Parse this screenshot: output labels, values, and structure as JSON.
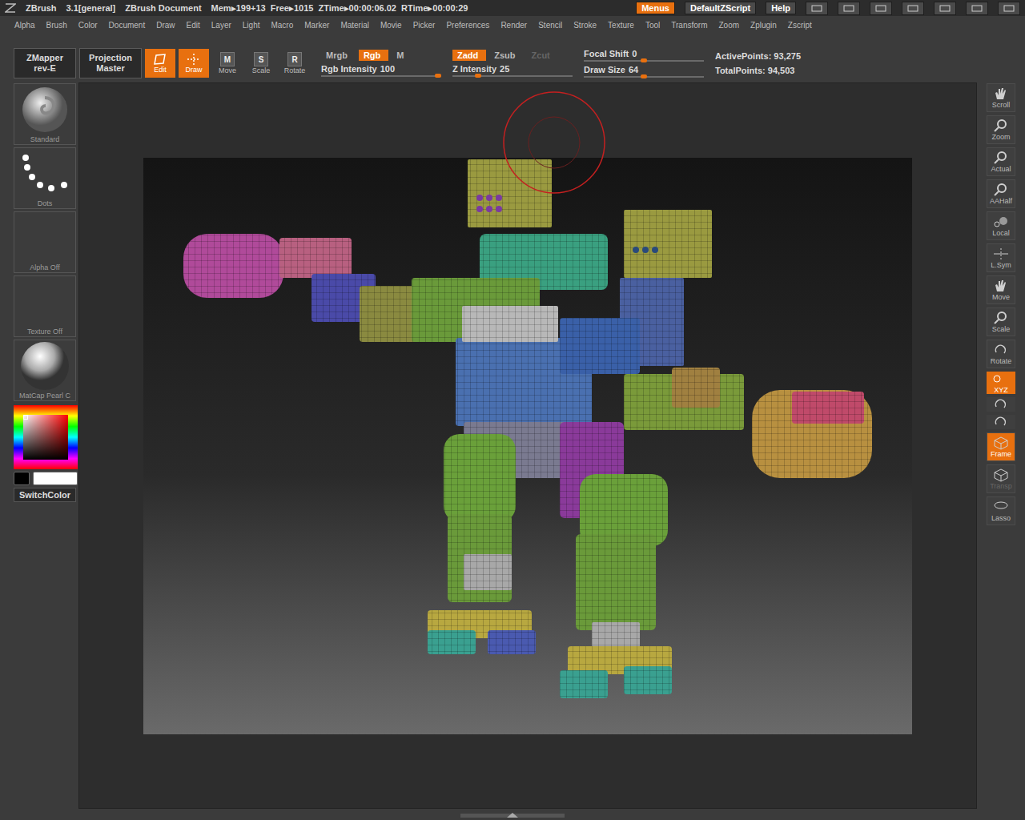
{
  "title_bar": {
    "app": "ZBrush",
    "version": "3.1[general]",
    "document": "ZBrush Document",
    "arrow": "▸",
    "stats": [
      {
        "label": "Mem",
        "value": "199+13"
      },
      {
        "label": "Free",
        "value": "1015"
      },
      {
        "label": "ZTime",
        "value": "00:00:06.02"
      },
      {
        "label": "RTime",
        "value": "00:00:29"
      }
    ],
    "buttons": [
      {
        "label": "Menus",
        "on": true
      },
      {
        "label": "DefaultZScript",
        "on": false
      },
      {
        "label": "Help",
        "on": false
      }
    ]
  },
  "menu": [
    "Alpha",
    "Brush",
    "Color",
    "Document",
    "Draw",
    "Edit",
    "Layer",
    "Light",
    "Macro",
    "Marker",
    "Material",
    "Movie",
    "Picker",
    "Preferences",
    "Render",
    "Stencil",
    "Stroke",
    "Texture",
    "Tool",
    "Transform",
    "Zoom",
    "Zplugin",
    "Zscript"
  ],
  "toolbar": {
    "plugins": [
      {
        "lines": [
          "ZMapper",
          "rev-E"
        ]
      },
      {
        "lines": [
          "Projection",
          "Master"
        ]
      }
    ],
    "modes": [
      {
        "label": "Edit",
        "kind": "edit",
        "key": "",
        "on": true
      },
      {
        "label": "Draw",
        "kind": "draw",
        "key": "",
        "on": true
      },
      {
        "label": "Move",
        "kind": "letter",
        "key": "M",
        "on": false
      },
      {
        "label": "Scale",
        "kind": "letter",
        "key": "S",
        "on": false
      },
      {
        "label": "Rotate",
        "kind": "letter",
        "key": "R",
        "on": false
      }
    ],
    "rgb_toggles": [
      {
        "label": "Mrgb",
        "on": false,
        "disabled": false
      },
      {
        "label": "Rgb",
        "on": true,
        "disabled": false
      },
      {
        "label": "M",
        "on": false,
        "disabled": false
      }
    ],
    "rgb_intensity": {
      "label": "Rgb Intensity",
      "value": "100",
      "level": 1
    },
    "z_toggles": [
      {
        "label": "Zadd",
        "on": true,
        "disabled": false
      },
      {
        "label": "Zsub",
        "on": false,
        "disabled": false
      },
      {
        "label": "Zcut",
        "on": false,
        "disabled": true
      }
    ],
    "z_intensity": {
      "label": "Z Intensity",
      "value": "25",
      "level": 0.2
    },
    "focal_shift": {
      "label": "Focal Shift",
      "value": "0",
      "level": 0.5
    },
    "draw_size": {
      "label": "Draw Size",
      "value": "64",
      "level": 0.5
    },
    "points": [
      {
        "label": "ActivePoints:",
        "value": "93,275"
      },
      {
        "label": "TotalPoints:",
        "value": "94,503"
      }
    ]
  },
  "left_shelf": {
    "items": [
      {
        "label": "Standard",
        "kind": "brush"
      },
      {
        "label": "Dots",
        "kind": "stroke"
      },
      {
        "label": "Alpha Off",
        "kind": "empty"
      },
      {
        "label": "Texture Off",
        "kind": "empty"
      },
      {
        "label": "MatCap Pearl C",
        "kind": "material"
      }
    ],
    "color": {
      "hue": "#ff0000",
      "primary": "#000000",
      "secondary": "#ffffff"
    },
    "switch_label": "SwitchColor"
  },
  "right_shelf": {
    "items": [
      {
        "label": "Scroll",
        "kind": "button",
        "on": false,
        "disabled": false
      },
      {
        "label": "Zoom",
        "kind": "button",
        "on": false,
        "disabled": false
      },
      {
        "label": "Actual",
        "kind": "button",
        "on": false,
        "disabled": false
      },
      {
        "label": "AAHalf",
        "kind": "button",
        "on": false,
        "disabled": false
      },
      {
        "label": "Local",
        "kind": "button",
        "on": false,
        "disabled": false
      },
      {
        "label": "L.Sym",
        "kind": "button",
        "on": false,
        "disabled": false
      },
      {
        "label": "Move",
        "kind": "button",
        "on": false,
        "disabled": false
      },
      {
        "label": "Scale",
        "kind": "button",
        "on": false,
        "disabled": false
      },
      {
        "label": "Rotate",
        "kind": "button",
        "on": false,
        "disabled": false
      },
      {
        "label": "XYZ",
        "kind": "small",
        "on": true,
        "disabled": false
      },
      {
        "label": "",
        "kind": "icon",
        "on": false,
        "disabled": false
      },
      {
        "label": "",
        "kind": "icon",
        "on": false,
        "disabled": false
      },
      {
        "label": "Frame",
        "kind": "button",
        "on": true,
        "disabled": false
      },
      {
        "label": "Transp",
        "kind": "button",
        "on": false,
        "disabled": true
      },
      {
        "label": "Lasso",
        "kind": "button",
        "on": false,
        "disabled": false
      }
    ]
  }
}
